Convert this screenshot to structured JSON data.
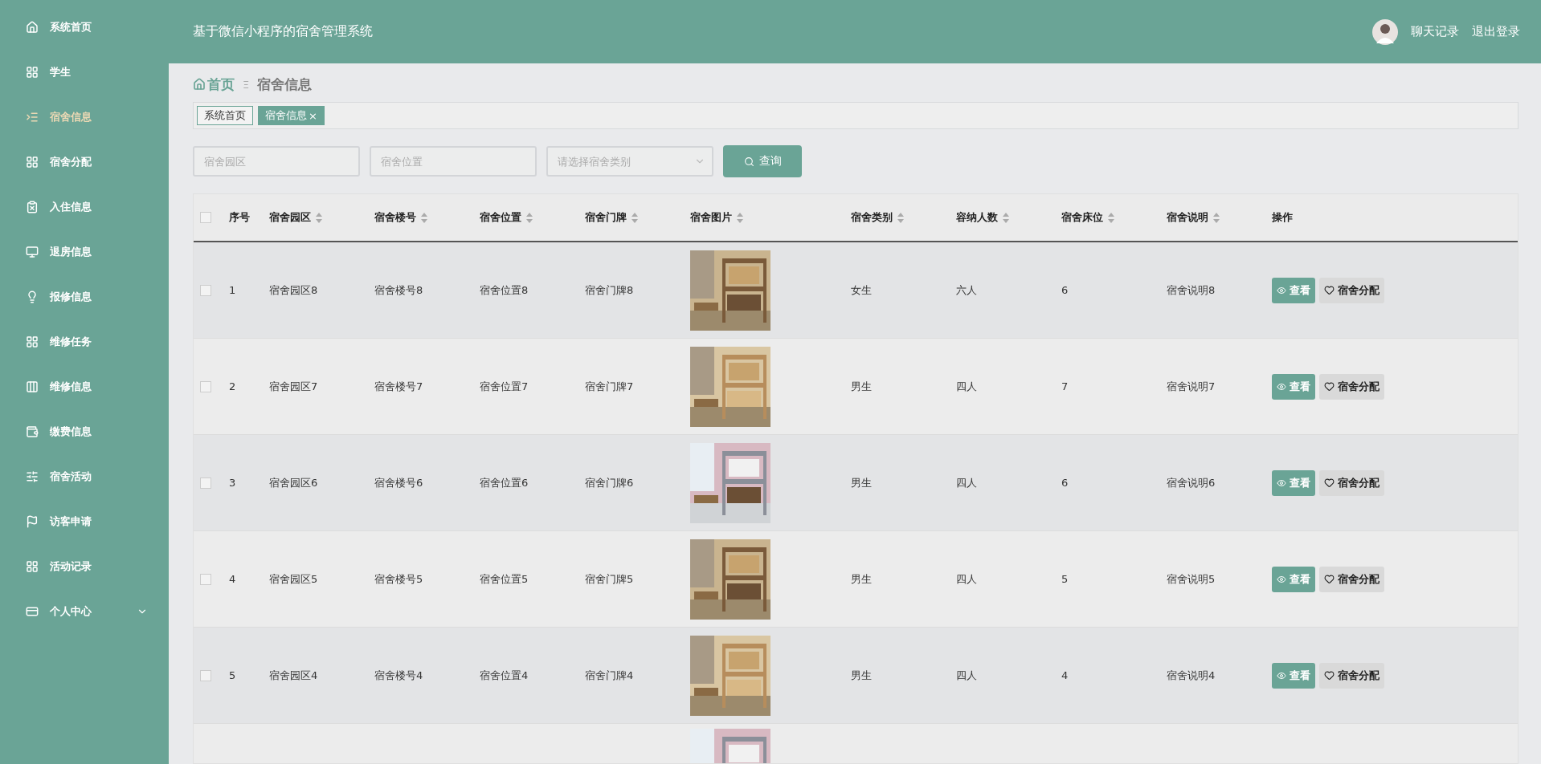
{
  "sidebar": {
    "items": [
      {
        "label": "系统首页",
        "selected": false
      },
      {
        "label": "学生",
        "selected": false
      },
      {
        "label": "宿舍信息",
        "selected": true
      },
      {
        "label": "宿舍分配",
        "selected": false
      },
      {
        "label": "入住信息",
        "selected": false
      },
      {
        "label": "退房信息",
        "selected": false
      },
      {
        "label": "报修信息",
        "selected": false
      },
      {
        "label": "维修任务",
        "selected": false
      },
      {
        "label": "维修信息",
        "selected": false
      },
      {
        "label": "缴费信息",
        "selected": false
      },
      {
        "label": "宿舍活动",
        "selected": false
      },
      {
        "label": "访客申请",
        "selected": false
      },
      {
        "label": "活动记录",
        "selected": false
      },
      {
        "label": "个人中心",
        "selected": false,
        "expanded": false
      }
    ]
  },
  "header": {
    "title": "基于微信小程序的宿舍管理系统",
    "links": [
      "聊天记录",
      "退出登录"
    ]
  },
  "breadcrumb": {
    "home": "首页",
    "separator": "Ξ",
    "current": "宿舍信息"
  },
  "tags": [
    {
      "label": "系统首页",
      "selected": false,
      "closable": false
    },
    {
      "label": "宿舍信息",
      "selected": true,
      "closable": true,
      "close": "×"
    }
  ],
  "filters": {
    "fields": [
      {
        "kind": "input",
        "placeholder": "宿舍园区"
      },
      {
        "kind": "input",
        "placeholder": "宿舍位置"
      },
      {
        "kind": "select",
        "placeholder": "请选择宿舍类别"
      }
    ],
    "search_button": "查询"
  },
  "table": {
    "columns": [
      {
        "label": "序号",
        "sortable": false
      },
      {
        "label": "宿舍园区",
        "sortable": true
      },
      {
        "label": "宿舍楼号",
        "sortable": true
      },
      {
        "label": "宿舍位置",
        "sortable": true
      },
      {
        "label": "宿舍门牌",
        "sortable": true
      },
      {
        "label": "宿舍图片",
        "sortable": true
      },
      {
        "label": "宿舍类别",
        "sortable": true
      },
      {
        "label": "容纳人数",
        "sortable": true
      },
      {
        "label": "宿舍床位",
        "sortable": true
      },
      {
        "label": "宿舍说明",
        "sortable": true
      },
      {
        "label": "操作",
        "sortable": false
      }
    ],
    "select_all_checked": false,
    "rows": [
      {
        "checked": false,
        "cells": [
          "1",
          "宿舍园区8",
          "宿舍楼号8",
          "宿舍位置8",
          "宿舍门牌8",
          {
            "kind": "picture"
          },
          "女生",
          "六人",
          "6",
          "宿舍说明8"
        ],
        "actions": [
          "查看",
          "宿舍分配"
        ]
      },
      {
        "checked": false,
        "cells": [
          "2",
          "宿舍园区7",
          "宿舍楼号7",
          "宿舍位置7",
          "宿舍门牌7",
          {
            "kind": "picture"
          },
          "男生",
          "四人",
          "7",
          "宿舍说明7"
        ],
        "actions": [
          "查看",
          "宿舍分配"
        ]
      },
      {
        "checked": false,
        "cells": [
          "3",
          "宿舍园区6",
          "宿舍楼号6",
          "宿舍位置6",
          "宿舍门牌6",
          {
            "kind": "picture"
          },
          "男生",
          "四人",
          "6",
          "宿舍说明6"
        ],
        "actions": [
          "查看",
          "宿舍分配"
        ]
      },
      {
        "checked": false,
        "cells": [
          "4",
          "宿舍园区5",
          "宿舍楼号5",
          "宿舍位置5",
          "宿舍门牌5",
          {
            "kind": "picture"
          },
          "男生",
          "四人",
          "5",
          "宿舍说明5"
        ],
        "actions": [
          "查看",
          "宿舍分配"
        ]
      },
      {
        "checked": false,
        "cells": [
          "5",
          "宿舍园区4",
          "宿舍楼号4",
          "宿舍位置4",
          "宿舍门牌4",
          {
            "kind": "picture"
          },
          "男生",
          "四人",
          "4",
          "宿舍说明4"
        ],
        "actions": [
          "查看",
          "宿舍分配"
        ]
      }
    ]
  }
}
